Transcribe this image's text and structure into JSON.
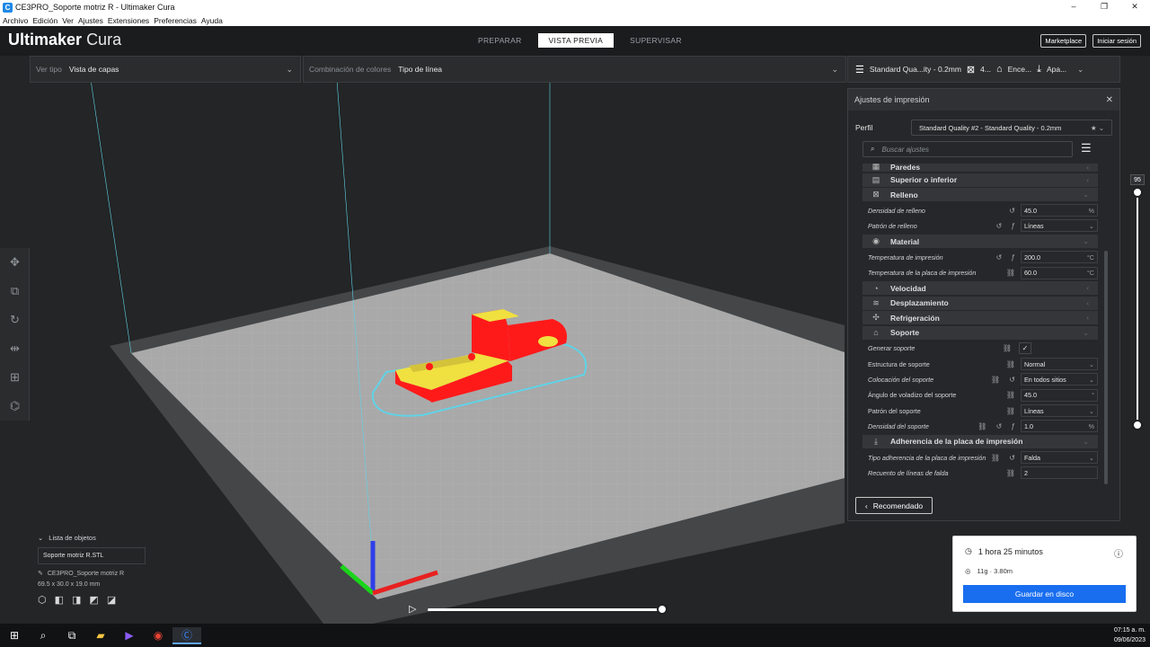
{
  "window": {
    "title": "CE3PRO_Soporte motriz R - Ultimaker Cura",
    "controls": [
      "–",
      "❐",
      "✕"
    ]
  },
  "menu": [
    "Archivo",
    "Edición",
    "Ver",
    "Ajustes",
    "Extensiones",
    "Preferencias",
    "Ayuda"
  ],
  "brand": {
    "bold": "Ultimaker",
    "light": "Cura"
  },
  "stages": [
    "PREPARAR",
    "VISTA PREVIA",
    "SUPERVISAR"
  ],
  "active_stage": "VISTA PREVIA",
  "top_right": {
    "marketplace": "Marketplace",
    "login": "Iniciar sesión"
  },
  "view_bar": {
    "view_type_label": "Ver tipo",
    "view_type_value": "Vista de capas",
    "color_scheme_label": "Combinación de colores",
    "color_scheme_value": "Tipo de línea"
  },
  "print_bar": {
    "profile": "Standard Qua...ity - 0.2mm",
    "infill": "4...",
    "support": "Ence...",
    "adhesion": "Apa..."
  },
  "print_settings": {
    "title": "Ajustes de impresión",
    "profile_label": "Perfil",
    "profile_value": "Standard Quality #2 - Standard Quality - 0.2mm",
    "search_placeholder": "Buscar ajustes",
    "categories": {
      "paredes": "Paredes",
      "superior": "Superior o inferior",
      "relleno": "Relleno",
      "material": "Material",
      "velocidad": "Velocidad",
      "desplazamiento": "Desplazamiento",
      "refrigeracion": "Refrigeración",
      "soporte": "Soporte",
      "adherencia": "Adherencia de la placa de impresión"
    },
    "settings": {
      "densidad_relleno": {
        "label": "Densidad de relleno",
        "value": "45.0",
        "unit": "%"
      },
      "patron_relleno": {
        "label": "Patrón de relleno",
        "value": "Líneas"
      },
      "temp_impresion": {
        "label": "Temperatura de impresión",
        "value": "200.0",
        "unit": "°C"
      },
      "temp_placa": {
        "label": "Temperatura de la placa de impresión",
        "value": "60.0",
        "unit": "°C"
      },
      "generar_soporte": {
        "label": "Generar soporte",
        "value": "✓"
      },
      "estructura_soporte": {
        "label": "Estructura de soporte",
        "value": "Normal"
      },
      "colocacion_soporte": {
        "label": "Colocación del soporte",
        "value": "En todos sitios"
      },
      "angulo_voladizo": {
        "label": "Ángulo de voladizo del soporte",
        "value": "45.0",
        "unit": "°"
      },
      "patron_soporte": {
        "label": "Patrón del soporte",
        "value": "Líneas"
      },
      "densidad_soporte": {
        "label": "Densidad del soporte",
        "value": "1.0",
        "unit": "%"
      },
      "tipo_adherencia": {
        "label": "Tipo adherencia de la placa de impresión",
        "value": "Falda"
      },
      "lineas_falda": {
        "label": "Recuento de líneas de falda",
        "value": "2"
      }
    },
    "recommended_button": "Recomendado"
  },
  "layer_slider": {
    "value": "95"
  },
  "object_list": {
    "header": "Lista de objetos",
    "item": "Soporte motriz R.STL",
    "name": "CE3PRO_Soporte motriz R",
    "dims": "69.5 x 30.0 x 19.0 mm"
  },
  "estimate": {
    "time": "1 hora 25 minutos",
    "material": "11g · 3.80m",
    "save_button": "Guardar en disco"
  },
  "taskbar": {
    "time": "07:15 a. m.",
    "date": "09/06/2023"
  },
  "colors": {
    "accent": "#196ef0",
    "model_wall": "#ff1a1a",
    "model_top": "#f0e040",
    "skirt": "#5fd3e8"
  }
}
